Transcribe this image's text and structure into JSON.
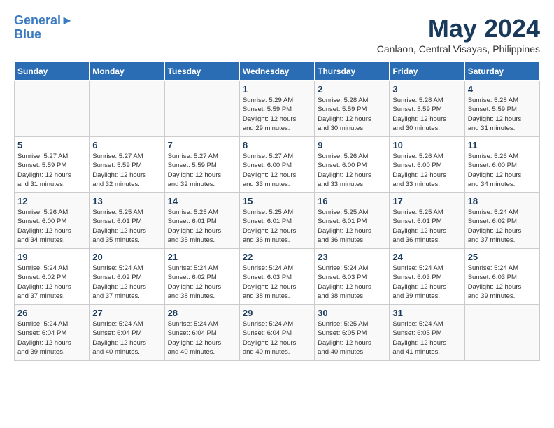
{
  "header": {
    "logo_line1": "General",
    "logo_line2": "Blue",
    "month_title": "May 2024",
    "subtitle": "Canlaon, Central Visayas, Philippines"
  },
  "weekdays": [
    "Sunday",
    "Monday",
    "Tuesday",
    "Wednesday",
    "Thursday",
    "Friday",
    "Saturday"
  ],
  "weeks": [
    [
      {
        "day": "",
        "info": ""
      },
      {
        "day": "",
        "info": ""
      },
      {
        "day": "",
        "info": ""
      },
      {
        "day": "1",
        "info": "Sunrise: 5:29 AM\nSunset: 5:59 PM\nDaylight: 12 hours\nand 29 minutes."
      },
      {
        "day": "2",
        "info": "Sunrise: 5:28 AM\nSunset: 5:59 PM\nDaylight: 12 hours\nand 30 minutes."
      },
      {
        "day": "3",
        "info": "Sunrise: 5:28 AM\nSunset: 5:59 PM\nDaylight: 12 hours\nand 30 minutes."
      },
      {
        "day": "4",
        "info": "Sunrise: 5:28 AM\nSunset: 5:59 PM\nDaylight: 12 hours\nand 31 minutes."
      }
    ],
    [
      {
        "day": "5",
        "info": "Sunrise: 5:27 AM\nSunset: 5:59 PM\nDaylight: 12 hours\nand 31 minutes."
      },
      {
        "day": "6",
        "info": "Sunrise: 5:27 AM\nSunset: 5:59 PM\nDaylight: 12 hours\nand 32 minutes."
      },
      {
        "day": "7",
        "info": "Sunrise: 5:27 AM\nSunset: 5:59 PM\nDaylight: 12 hours\nand 32 minutes."
      },
      {
        "day": "8",
        "info": "Sunrise: 5:27 AM\nSunset: 6:00 PM\nDaylight: 12 hours\nand 33 minutes."
      },
      {
        "day": "9",
        "info": "Sunrise: 5:26 AM\nSunset: 6:00 PM\nDaylight: 12 hours\nand 33 minutes."
      },
      {
        "day": "10",
        "info": "Sunrise: 5:26 AM\nSunset: 6:00 PM\nDaylight: 12 hours\nand 33 minutes."
      },
      {
        "day": "11",
        "info": "Sunrise: 5:26 AM\nSunset: 6:00 PM\nDaylight: 12 hours\nand 34 minutes."
      }
    ],
    [
      {
        "day": "12",
        "info": "Sunrise: 5:26 AM\nSunset: 6:00 PM\nDaylight: 12 hours\nand 34 minutes."
      },
      {
        "day": "13",
        "info": "Sunrise: 5:25 AM\nSunset: 6:01 PM\nDaylight: 12 hours\nand 35 minutes."
      },
      {
        "day": "14",
        "info": "Sunrise: 5:25 AM\nSunset: 6:01 PM\nDaylight: 12 hours\nand 35 minutes."
      },
      {
        "day": "15",
        "info": "Sunrise: 5:25 AM\nSunset: 6:01 PM\nDaylight: 12 hours\nand 36 minutes."
      },
      {
        "day": "16",
        "info": "Sunrise: 5:25 AM\nSunset: 6:01 PM\nDaylight: 12 hours\nand 36 minutes."
      },
      {
        "day": "17",
        "info": "Sunrise: 5:25 AM\nSunset: 6:01 PM\nDaylight: 12 hours\nand 36 minutes."
      },
      {
        "day": "18",
        "info": "Sunrise: 5:24 AM\nSunset: 6:02 PM\nDaylight: 12 hours\nand 37 minutes."
      }
    ],
    [
      {
        "day": "19",
        "info": "Sunrise: 5:24 AM\nSunset: 6:02 PM\nDaylight: 12 hours\nand 37 minutes."
      },
      {
        "day": "20",
        "info": "Sunrise: 5:24 AM\nSunset: 6:02 PM\nDaylight: 12 hours\nand 37 minutes."
      },
      {
        "day": "21",
        "info": "Sunrise: 5:24 AM\nSunset: 6:02 PM\nDaylight: 12 hours\nand 38 minutes."
      },
      {
        "day": "22",
        "info": "Sunrise: 5:24 AM\nSunset: 6:03 PM\nDaylight: 12 hours\nand 38 minutes."
      },
      {
        "day": "23",
        "info": "Sunrise: 5:24 AM\nSunset: 6:03 PM\nDaylight: 12 hours\nand 38 minutes."
      },
      {
        "day": "24",
        "info": "Sunrise: 5:24 AM\nSunset: 6:03 PM\nDaylight: 12 hours\nand 39 minutes."
      },
      {
        "day": "25",
        "info": "Sunrise: 5:24 AM\nSunset: 6:03 PM\nDaylight: 12 hours\nand 39 minutes."
      }
    ],
    [
      {
        "day": "26",
        "info": "Sunrise: 5:24 AM\nSunset: 6:04 PM\nDaylight: 12 hours\nand 39 minutes."
      },
      {
        "day": "27",
        "info": "Sunrise: 5:24 AM\nSunset: 6:04 PM\nDaylight: 12 hours\nand 40 minutes."
      },
      {
        "day": "28",
        "info": "Sunrise: 5:24 AM\nSunset: 6:04 PM\nDaylight: 12 hours\nand 40 minutes."
      },
      {
        "day": "29",
        "info": "Sunrise: 5:24 AM\nSunset: 6:04 PM\nDaylight: 12 hours\nand 40 minutes."
      },
      {
        "day": "30",
        "info": "Sunrise: 5:25 AM\nSunset: 6:05 PM\nDaylight: 12 hours\nand 40 minutes."
      },
      {
        "day": "31",
        "info": "Sunrise: 5:24 AM\nSunset: 6:05 PM\nDaylight: 12 hours\nand 41 minutes."
      },
      {
        "day": "",
        "info": ""
      }
    ]
  ]
}
